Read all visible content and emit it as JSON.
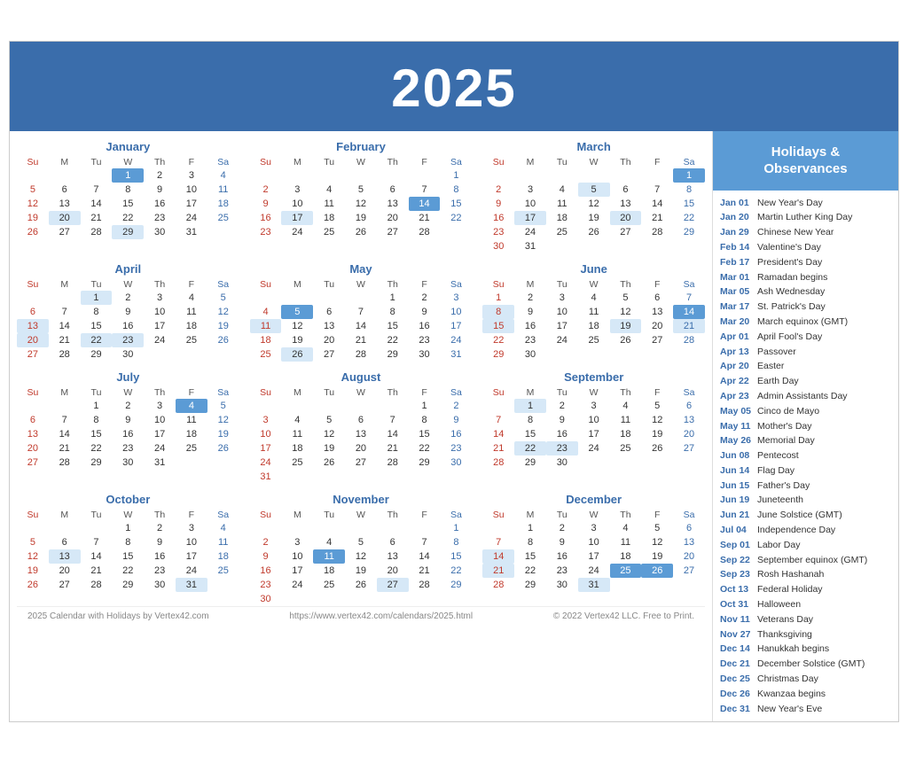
{
  "header": {
    "year": "2025"
  },
  "sidebar": {
    "title": "Holidays &\nObservances",
    "holidays": [
      {
        "date": "Jan 01",
        "name": "New Year's Day"
      },
      {
        "date": "Jan 20",
        "name": "Martin Luther King Day"
      },
      {
        "date": "Jan 29",
        "name": "Chinese New Year"
      },
      {
        "date": "Feb 14",
        "name": "Valentine's Day"
      },
      {
        "date": "Feb 17",
        "name": "President's Day"
      },
      {
        "date": "Mar 01",
        "name": "Ramadan begins"
      },
      {
        "date": "Mar 05",
        "name": "Ash Wednesday"
      },
      {
        "date": "Mar 17",
        "name": "St. Patrick's Day"
      },
      {
        "date": "Mar 20",
        "name": "March equinox (GMT)"
      },
      {
        "date": "Apr 01",
        "name": "April Fool's Day"
      },
      {
        "date": "Apr 13",
        "name": "Passover"
      },
      {
        "date": "Apr 20",
        "name": "Easter"
      },
      {
        "date": "Apr 22",
        "name": "Earth Day"
      },
      {
        "date": "Apr 23",
        "name": "Admin Assistants Day"
      },
      {
        "date": "May 05",
        "name": "Cinco de Mayo"
      },
      {
        "date": "May 11",
        "name": "Mother's Day"
      },
      {
        "date": "May 26",
        "name": "Memorial Day"
      },
      {
        "date": "Jun 08",
        "name": "Pentecost"
      },
      {
        "date": "Jun 14",
        "name": "Flag Day"
      },
      {
        "date": "Jun 15",
        "name": "Father's Day"
      },
      {
        "date": "Jun 19",
        "name": "Juneteenth"
      },
      {
        "date": "Jun 21",
        "name": "June Solstice (GMT)"
      },
      {
        "date": "Jul 04",
        "name": "Independence Day"
      },
      {
        "date": "Sep 01",
        "name": "Labor Day"
      },
      {
        "date": "Sep 22",
        "name": "September equinox (GMT)"
      },
      {
        "date": "Sep 23",
        "name": "Rosh Hashanah"
      },
      {
        "date": "Oct 13",
        "name": "Federal Holiday"
      },
      {
        "date": "Oct 31",
        "name": "Halloween"
      },
      {
        "date": "Nov 11",
        "name": "Veterans Day"
      },
      {
        "date": "Nov 27",
        "name": "Thanksgiving"
      },
      {
        "date": "Dec 14",
        "name": "Hanukkah begins"
      },
      {
        "date": "Dec 21",
        "name": "December Solstice (GMT)"
      },
      {
        "date": "Dec 25",
        "name": "Christmas Day"
      },
      {
        "date": "Dec 26",
        "name": "Kwanzaa begins"
      },
      {
        "date": "Dec 31",
        "name": "New Year's Eve"
      }
    ]
  },
  "footer": {
    "left": "2025 Calendar with Holidays by Vertex42.com",
    "center": "https://www.vertex42.com/calendars/2025.html",
    "right": "© 2022 Vertex42 LLC. Free to Print."
  },
  "months": [
    {
      "name": "January",
      "weeks": [
        [
          null,
          null,
          null,
          1,
          2,
          3,
          4
        ],
        [
          5,
          6,
          7,
          8,
          9,
          10,
          11
        ],
        [
          12,
          13,
          14,
          15,
          16,
          17,
          18
        ],
        [
          19,
          20,
          21,
          22,
          23,
          24,
          25
        ],
        [
          26,
          27,
          28,
          29,
          30,
          31,
          null
        ]
      ],
      "highlights": [
        1
      ],
      "lightHighlights": [
        20,
        29
      ],
      "boldDays": []
    },
    {
      "name": "February",
      "weeks": [
        [
          null,
          null,
          null,
          null,
          null,
          null,
          1
        ],
        [
          2,
          3,
          4,
          5,
          6,
          7,
          8
        ],
        [
          9,
          10,
          11,
          12,
          13,
          14,
          15
        ],
        [
          16,
          17,
          18,
          19,
          20,
          21,
          22
        ],
        [
          23,
          24,
          25,
          26,
          27,
          28,
          null
        ]
      ],
      "highlights": [
        14
      ],
      "lightHighlights": [
        17
      ],
      "boldDays": []
    },
    {
      "name": "March",
      "weeks": [
        [
          null,
          null,
          null,
          null,
          null,
          null,
          1
        ],
        [
          2,
          3,
          4,
          5,
          6,
          7,
          8
        ],
        [
          9,
          10,
          11,
          12,
          13,
          14,
          15
        ],
        [
          16,
          17,
          18,
          19,
          20,
          21,
          22
        ],
        [
          23,
          24,
          25,
          26,
          27,
          28,
          29
        ],
        [
          30,
          31,
          null,
          null,
          null,
          null,
          null
        ]
      ],
      "highlights": [
        1
      ],
      "lightHighlights": [
        5,
        17,
        20
      ],
      "boldDays": []
    },
    {
      "name": "April",
      "weeks": [
        [
          null,
          null,
          1,
          2,
          3,
          4,
          5
        ],
        [
          6,
          7,
          8,
          9,
          10,
          11,
          12
        ],
        [
          13,
          14,
          15,
          16,
          17,
          18,
          19
        ],
        [
          20,
          21,
          22,
          23,
          24,
          25,
          26
        ],
        [
          27,
          28,
          29,
          30,
          null,
          null,
          null
        ]
      ],
      "highlights": [],
      "lightHighlights": [
        1,
        13,
        20,
        22,
        23
      ],
      "boldDays": []
    },
    {
      "name": "May",
      "weeks": [
        [
          null,
          null,
          null,
          null,
          1,
          2,
          3
        ],
        [
          4,
          5,
          6,
          7,
          8,
          9,
          10
        ],
        [
          11,
          12,
          13,
          14,
          15,
          16,
          17
        ],
        [
          18,
          19,
          20,
          21,
          22,
          23,
          24
        ],
        [
          25,
          26,
          27,
          28,
          29,
          30,
          31
        ]
      ],
      "highlights": [
        5
      ],
      "lightHighlights": [
        11,
        26
      ],
      "boldDays": []
    },
    {
      "name": "June",
      "weeks": [
        [
          1,
          2,
          3,
          4,
          5,
          6,
          7
        ],
        [
          8,
          9,
          10,
          11,
          12,
          13,
          14
        ],
        [
          15,
          16,
          17,
          18,
          19,
          20,
          21
        ],
        [
          22,
          23,
          24,
          25,
          26,
          27,
          28
        ],
        [
          29,
          30,
          null,
          null,
          null,
          null,
          null
        ]
      ],
      "highlights": [
        14
      ],
      "lightHighlights": [
        8,
        15,
        19,
        21
      ],
      "boldDays": []
    },
    {
      "name": "July",
      "weeks": [
        [
          null,
          null,
          1,
          2,
          3,
          4,
          5
        ],
        [
          6,
          7,
          8,
          9,
          10,
          11,
          12
        ],
        [
          13,
          14,
          15,
          16,
          17,
          18,
          19
        ],
        [
          20,
          21,
          22,
          23,
          24,
          25,
          26
        ],
        [
          27,
          28,
          29,
          30,
          31,
          null,
          null
        ]
      ],
      "highlights": [
        4
      ],
      "lightHighlights": [],
      "boldDays": []
    },
    {
      "name": "August",
      "weeks": [
        [
          null,
          null,
          null,
          null,
          null,
          1,
          2
        ],
        [
          3,
          4,
          5,
          6,
          7,
          8,
          9
        ],
        [
          10,
          11,
          12,
          13,
          14,
          15,
          16
        ],
        [
          17,
          18,
          19,
          20,
          21,
          22,
          23
        ],
        [
          24,
          25,
          26,
          27,
          28,
          29,
          30
        ],
        [
          31,
          null,
          null,
          null,
          null,
          null,
          null
        ]
      ],
      "highlights": [],
      "lightHighlights": [],
      "boldDays": []
    },
    {
      "name": "September",
      "weeks": [
        [
          null,
          1,
          2,
          3,
          4,
          5,
          6
        ],
        [
          7,
          8,
          9,
          10,
          11,
          12,
          13
        ],
        [
          14,
          15,
          16,
          17,
          18,
          19,
          20
        ],
        [
          21,
          22,
          23,
          24,
          25,
          26,
          27
        ],
        [
          28,
          29,
          30,
          null,
          null,
          null,
          null
        ]
      ],
      "highlights": [],
      "lightHighlights": [
        1,
        22,
        23
      ],
      "boldDays": []
    },
    {
      "name": "October",
      "weeks": [
        [
          null,
          null,
          null,
          1,
          2,
          3,
          4
        ],
        [
          5,
          6,
          7,
          8,
          9,
          10,
          11
        ],
        [
          12,
          13,
          14,
          15,
          16,
          17,
          18
        ],
        [
          19,
          20,
          21,
          22,
          23,
          24,
          25
        ],
        [
          26,
          27,
          28,
          29,
          30,
          31,
          null
        ]
      ],
      "highlights": [],
      "lightHighlights": [
        13,
        31
      ],
      "boldDays": []
    },
    {
      "name": "November",
      "weeks": [
        [
          null,
          null,
          null,
          null,
          null,
          null,
          1
        ],
        [
          2,
          3,
          4,
          5,
          6,
          7,
          8
        ],
        [
          9,
          10,
          11,
          12,
          13,
          14,
          15
        ],
        [
          16,
          17,
          18,
          19,
          20,
          21,
          22
        ],
        [
          23,
          24,
          25,
          26,
          27,
          28,
          29
        ],
        [
          30,
          null,
          null,
          null,
          null,
          null,
          null
        ]
      ],
      "highlights": [
        11
      ],
      "lightHighlights": [
        27
      ],
      "boldDays": []
    },
    {
      "name": "December",
      "weeks": [
        [
          null,
          1,
          2,
          3,
          4,
          5,
          6
        ],
        [
          7,
          8,
          9,
          10,
          11,
          12,
          13
        ],
        [
          14,
          15,
          16,
          17,
          18,
          19,
          20
        ],
        [
          21,
          22,
          23,
          24,
          25,
          26,
          27
        ],
        [
          28,
          29,
          30,
          31,
          null,
          null,
          null
        ]
      ],
      "highlights": [
        25,
        26
      ],
      "lightHighlights": [
        14,
        21,
        31
      ],
      "boldDays": []
    }
  ]
}
